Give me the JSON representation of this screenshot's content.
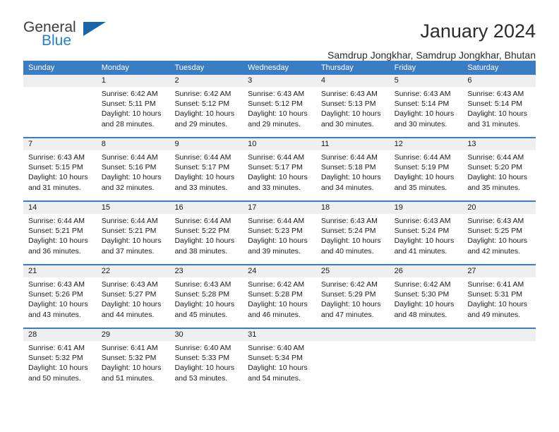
{
  "brand": {
    "name_top": "General",
    "name_bottom": "Blue",
    "color_top": "#3c3c3c",
    "color_bottom": "#2280c6",
    "triangle_color": "#1565a8"
  },
  "header": {
    "title": "January 2024",
    "subtitle": "Samdrup Jongkhar, Samdrup Jongkhar, Bhutan"
  },
  "calendar": {
    "header_bg": "#3b7dc4",
    "day_number_bg": "#efefef",
    "weekdays": [
      "Sunday",
      "Monday",
      "Tuesday",
      "Wednesday",
      "Thursday",
      "Friday",
      "Saturday"
    ],
    "weeks": [
      [
        {
          "day": "",
          "lines": []
        },
        {
          "day": "1",
          "lines": [
            "Sunrise: 6:42 AM",
            "Sunset: 5:11 PM",
            "Daylight: 10 hours",
            "and 28 minutes."
          ]
        },
        {
          "day": "2",
          "lines": [
            "Sunrise: 6:42 AM",
            "Sunset: 5:12 PM",
            "Daylight: 10 hours",
            "and 29 minutes."
          ]
        },
        {
          "day": "3",
          "lines": [
            "Sunrise: 6:43 AM",
            "Sunset: 5:12 PM",
            "Daylight: 10 hours",
            "and 29 minutes."
          ]
        },
        {
          "day": "4",
          "lines": [
            "Sunrise: 6:43 AM",
            "Sunset: 5:13 PM",
            "Daylight: 10 hours",
            "and 30 minutes."
          ]
        },
        {
          "day": "5",
          "lines": [
            "Sunrise: 6:43 AM",
            "Sunset: 5:14 PM",
            "Daylight: 10 hours",
            "and 30 minutes."
          ]
        },
        {
          "day": "6",
          "lines": [
            "Sunrise: 6:43 AM",
            "Sunset: 5:14 PM",
            "Daylight: 10 hours",
            "and 31 minutes."
          ]
        }
      ],
      [
        {
          "day": "7",
          "lines": [
            "Sunrise: 6:43 AM",
            "Sunset: 5:15 PM",
            "Daylight: 10 hours",
            "and 31 minutes."
          ]
        },
        {
          "day": "8",
          "lines": [
            "Sunrise: 6:44 AM",
            "Sunset: 5:16 PM",
            "Daylight: 10 hours",
            "and 32 minutes."
          ]
        },
        {
          "day": "9",
          "lines": [
            "Sunrise: 6:44 AM",
            "Sunset: 5:17 PM",
            "Daylight: 10 hours",
            "and 33 minutes."
          ]
        },
        {
          "day": "10",
          "lines": [
            "Sunrise: 6:44 AM",
            "Sunset: 5:17 PM",
            "Daylight: 10 hours",
            "and 33 minutes."
          ]
        },
        {
          "day": "11",
          "lines": [
            "Sunrise: 6:44 AM",
            "Sunset: 5:18 PM",
            "Daylight: 10 hours",
            "and 34 minutes."
          ]
        },
        {
          "day": "12",
          "lines": [
            "Sunrise: 6:44 AM",
            "Sunset: 5:19 PM",
            "Daylight: 10 hours",
            "and 35 minutes."
          ]
        },
        {
          "day": "13",
          "lines": [
            "Sunrise: 6:44 AM",
            "Sunset: 5:20 PM",
            "Daylight: 10 hours",
            "and 35 minutes."
          ]
        }
      ],
      [
        {
          "day": "14",
          "lines": [
            "Sunrise: 6:44 AM",
            "Sunset: 5:21 PM",
            "Daylight: 10 hours",
            "and 36 minutes."
          ]
        },
        {
          "day": "15",
          "lines": [
            "Sunrise: 6:44 AM",
            "Sunset: 5:21 PM",
            "Daylight: 10 hours",
            "and 37 minutes."
          ]
        },
        {
          "day": "16",
          "lines": [
            "Sunrise: 6:44 AM",
            "Sunset: 5:22 PM",
            "Daylight: 10 hours",
            "and 38 minutes."
          ]
        },
        {
          "day": "17",
          "lines": [
            "Sunrise: 6:44 AM",
            "Sunset: 5:23 PM",
            "Daylight: 10 hours",
            "and 39 minutes."
          ]
        },
        {
          "day": "18",
          "lines": [
            "Sunrise: 6:43 AM",
            "Sunset: 5:24 PM",
            "Daylight: 10 hours",
            "and 40 minutes."
          ]
        },
        {
          "day": "19",
          "lines": [
            "Sunrise: 6:43 AM",
            "Sunset: 5:24 PM",
            "Daylight: 10 hours",
            "and 41 minutes."
          ]
        },
        {
          "day": "20",
          "lines": [
            "Sunrise: 6:43 AM",
            "Sunset: 5:25 PM",
            "Daylight: 10 hours",
            "and 42 minutes."
          ]
        }
      ],
      [
        {
          "day": "21",
          "lines": [
            "Sunrise: 6:43 AM",
            "Sunset: 5:26 PM",
            "Daylight: 10 hours",
            "and 43 minutes."
          ]
        },
        {
          "day": "22",
          "lines": [
            "Sunrise: 6:43 AM",
            "Sunset: 5:27 PM",
            "Daylight: 10 hours",
            "and 44 minutes."
          ]
        },
        {
          "day": "23",
          "lines": [
            "Sunrise: 6:43 AM",
            "Sunset: 5:28 PM",
            "Daylight: 10 hours",
            "and 45 minutes."
          ]
        },
        {
          "day": "24",
          "lines": [
            "Sunrise: 6:42 AM",
            "Sunset: 5:28 PM",
            "Daylight: 10 hours",
            "and 46 minutes."
          ]
        },
        {
          "day": "25",
          "lines": [
            "Sunrise: 6:42 AM",
            "Sunset: 5:29 PM",
            "Daylight: 10 hours",
            "and 47 minutes."
          ]
        },
        {
          "day": "26",
          "lines": [
            "Sunrise: 6:42 AM",
            "Sunset: 5:30 PM",
            "Daylight: 10 hours",
            "and 48 minutes."
          ]
        },
        {
          "day": "27",
          "lines": [
            "Sunrise: 6:41 AM",
            "Sunset: 5:31 PM",
            "Daylight: 10 hours",
            "and 49 minutes."
          ]
        }
      ],
      [
        {
          "day": "28",
          "lines": [
            "Sunrise: 6:41 AM",
            "Sunset: 5:32 PM",
            "Daylight: 10 hours",
            "and 50 minutes."
          ]
        },
        {
          "day": "29",
          "lines": [
            "Sunrise: 6:41 AM",
            "Sunset: 5:32 PM",
            "Daylight: 10 hours",
            "and 51 minutes."
          ]
        },
        {
          "day": "30",
          "lines": [
            "Sunrise: 6:40 AM",
            "Sunset: 5:33 PM",
            "Daylight: 10 hours",
            "and 53 minutes."
          ]
        },
        {
          "day": "31",
          "lines": [
            "Sunrise: 6:40 AM",
            "Sunset: 5:34 PM",
            "Daylight: 10 hours",
            "and 54 minutes."
          ]
        },
        {
          "day": "",
          "lines": []
        },
        {
          "day": "",
          "lines": []
        },
        {
          "day": "",
          "lines": []
        }
      ]
    ]
  }
}
